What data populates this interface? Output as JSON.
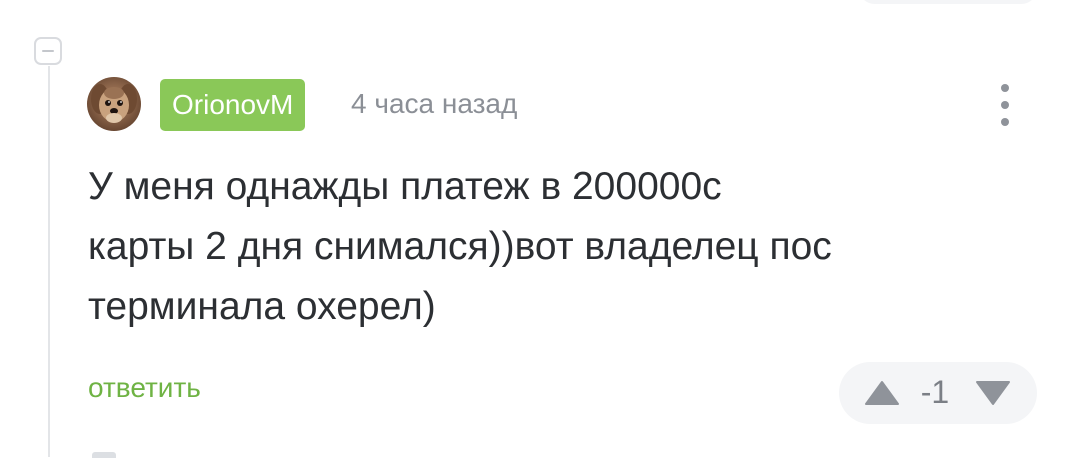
{
  "comment": {
    "author": "OrionovM",
    "timestamp": "4 часа назад",
    "avatar": "avatar-photo-dog",
    "body_lines": [
      "У меня однажды платеж в 200000с",
      "карты 2 дня снимался))вот владелец пос",
      "терминала охерел)"
    ],
    "reply_label": "ответить",
    "rating": "-1"
  },
  "icons": {
    "collapse": "minus-square-icon",
    "more": "vertical-dots-icon",
    "vote_up": "triangle-up-icon",
    "vote_down": "triangle-down-icon"
  },
  "colors": {
    "author_badge_bg": "#8ac858",
    "reply_link": "#6fb344",
    "timestamp": "#8b8f96",
    "body_text": "#2c2f33",
    "vote_arrows": "#8f939a"
  }
}
